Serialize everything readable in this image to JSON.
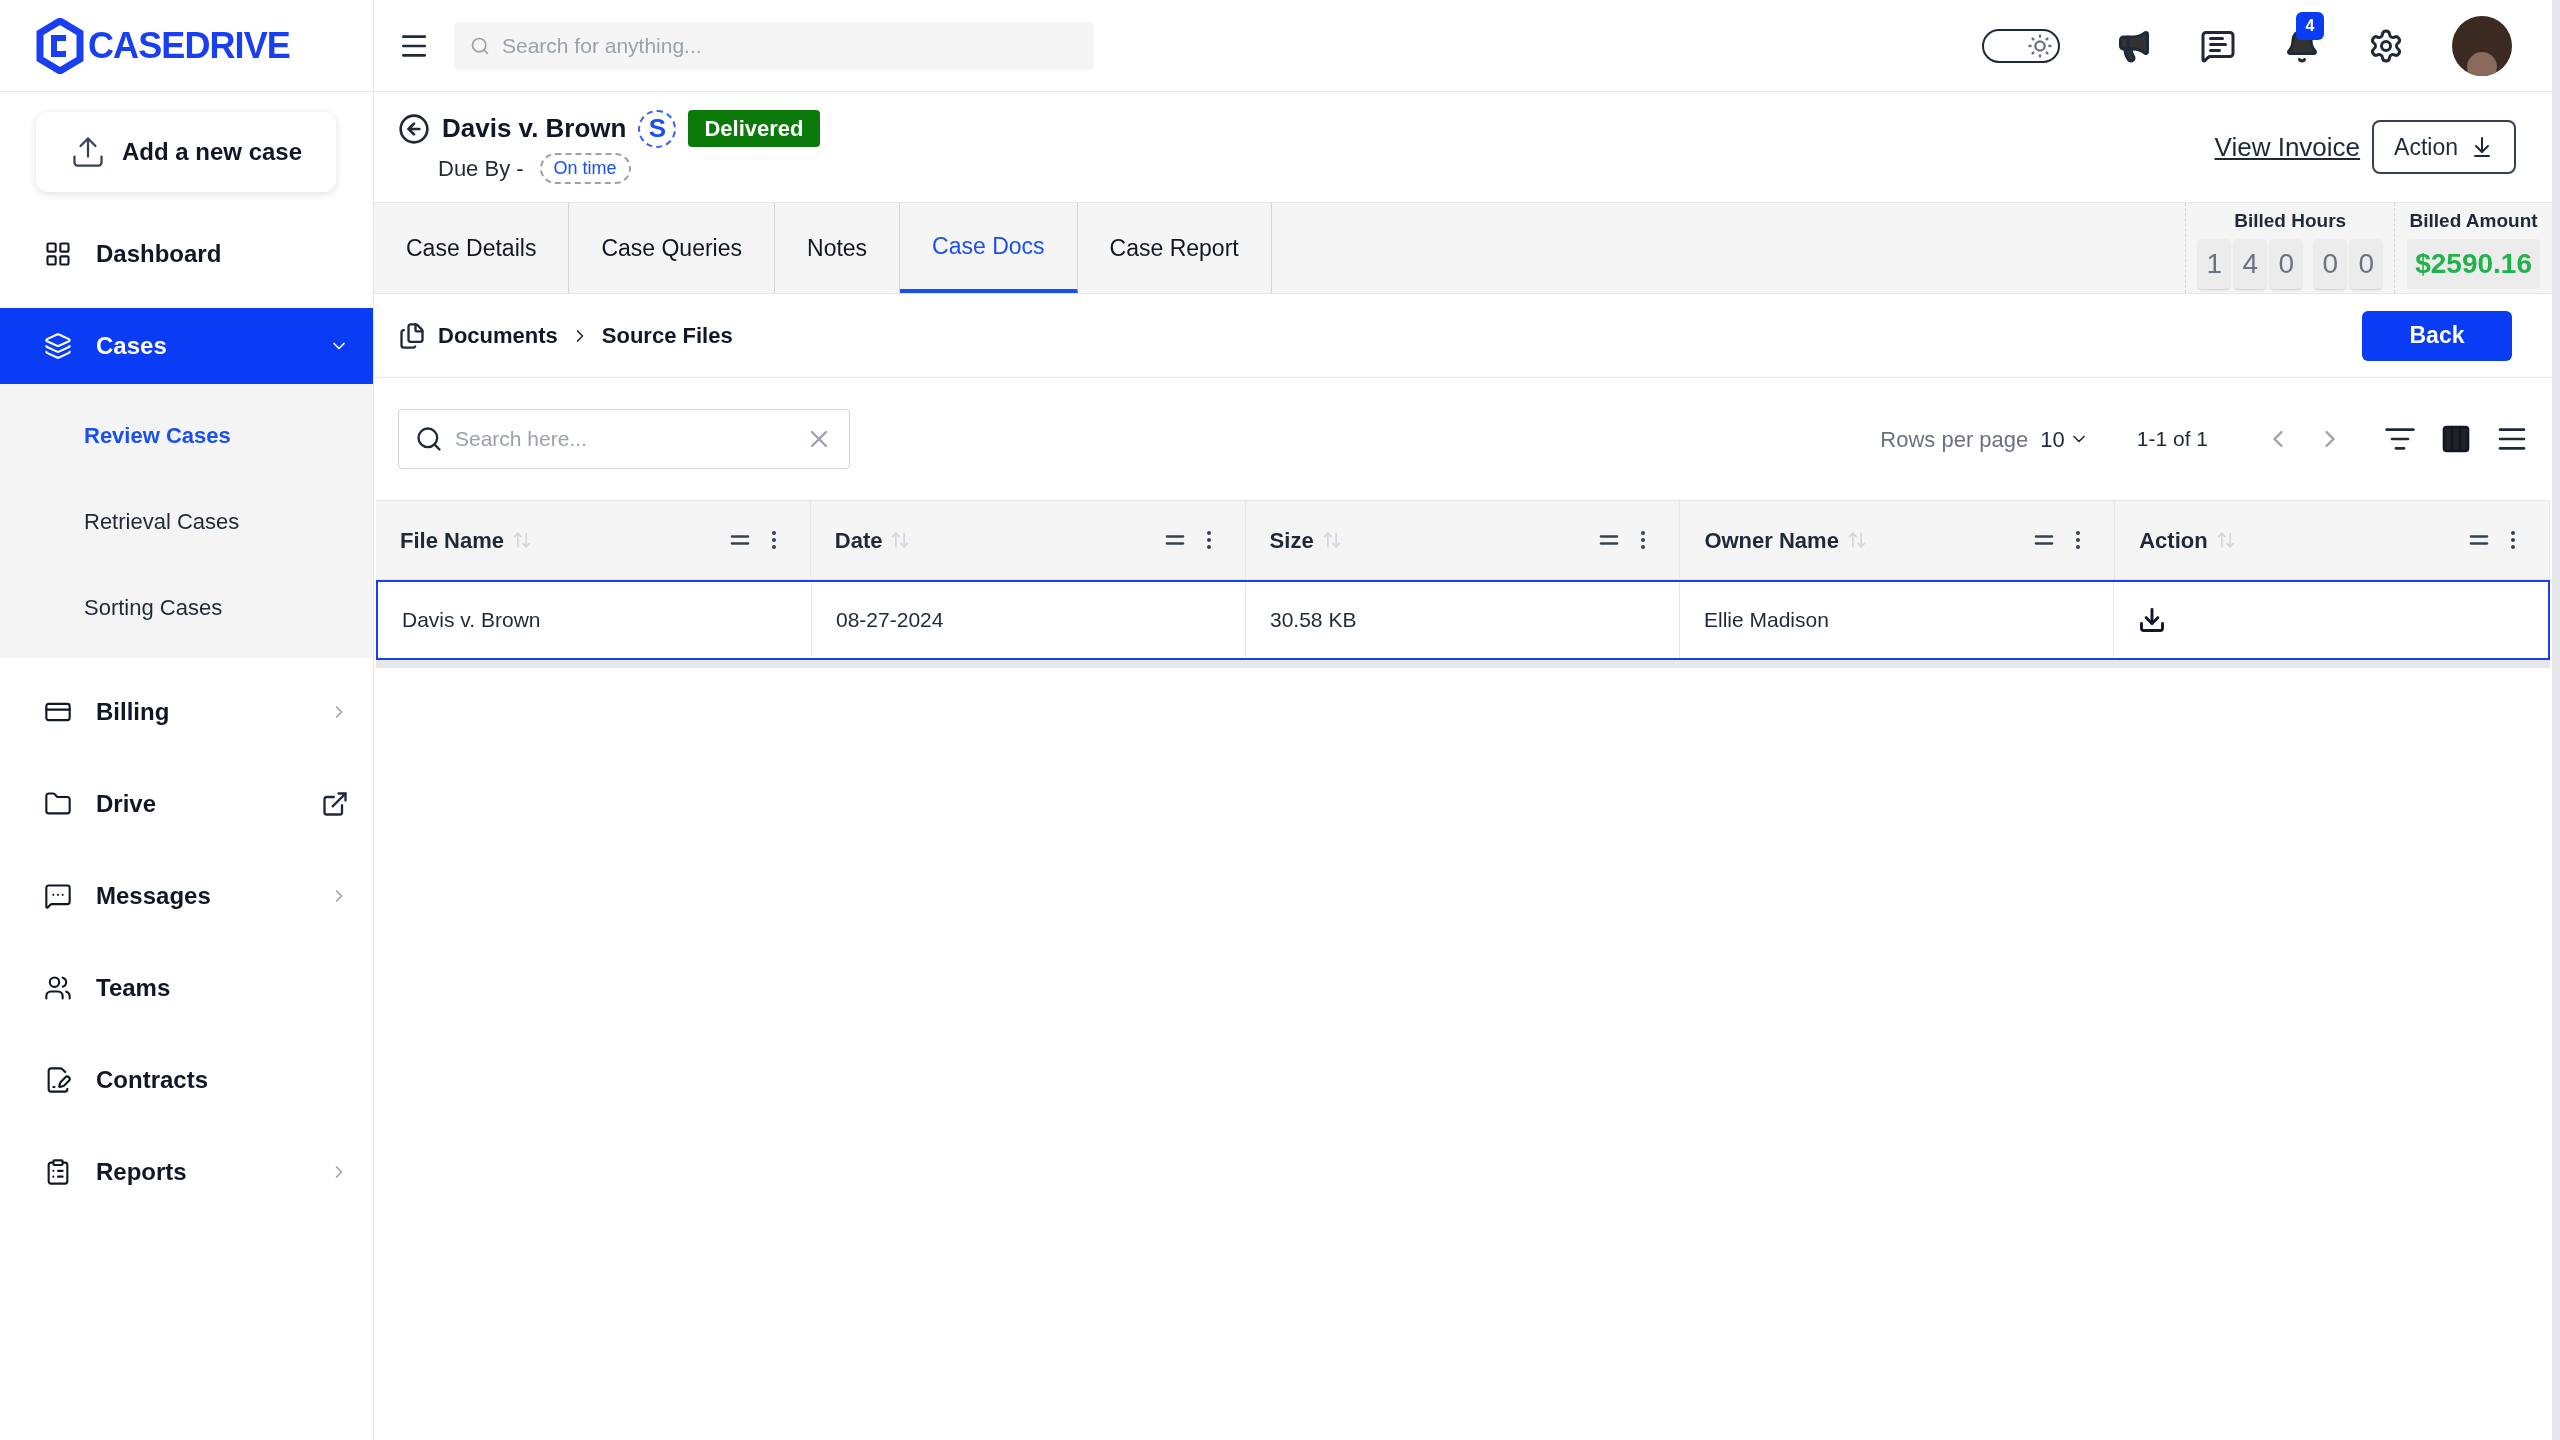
{
  "brand": {
    "name": "CASEDRIVE"
  },
  "sidebar": {
    "add_button": "Add a new case",
    "items": [
      {
        "label": "Dashboard",
        "selected": false
      },
      {
        "label": "Cases",
        "selected": true,
        "expanded": true,
        "children": [
          {
            "label": "Review Cases",
            "selected": true
          },
          {
            "label": "Retrieval Cases",
            "selected": false
          },
          {
            "label": "Sorting Cases",
            "selected": false
          }
        ]
      },
      {
        "label": "Billing",
        "selected": false
      },
      {
        "label": "Drive",
        "selected": false
      },
      {
        "label": "Messages",
        "selected": false
      },
      {
        "label": "Teams",
        "selected": false
      },
      {
        "label": "Contracts",
        "selected": false
      },
      {
        "label": "Reports",
        "selected": false
      }
    ]
  },
  "topbar": {
    "theme_toggle": {
      "on": false
    },
    "search": {
      "placeholder": "Search for anything..."
    },
    "notifications_count": "4"
  },
  "case": {
    "title": "Davis v. Brown",
    "initial": "S",
    "status": "Delivered",
    "due_label": "Due By -",
    "due_status": "On time",
    "view_invoice": "View Invoice",
    "action_button": "Action"
  },
  "tabs": [
    {
      "label": "Case Details",
      "selected": false
    },
    {
      "label": "Case Queries",
      "selected": false
    },
    {
      "label": "Notes",
      "selected": false
    },
    {
      "label": "Case Docs",
      "selected": true
    },
    {
      "label": "Case Report",
      "selected": false
    }
  ],
  "billed_hours": {
    "label": "Billed Hours",
    "groups": [
      [
        "1",
        "4",
        "0"
      ],
      [
        "0",
        "0"
      ]
    ]
  },
  "billed_amount": {
    "label": "Billed Amount",
    "value": "$2590.16"
  },
  "breadcrumb": [
    "Documents",
    "Source Files"
  ],
  "back_button": "Back",
  "table_toolbar": {
    "search": {
      "placeholder": "Search here..."
    },
    "rows_per_page_label": "Rows per page",
    "rows_per_page": "10",
    "range": "1-1 of 1"
  },
  "table": {
    "columns": [
      "File Name",
      "Date",
      "Size",
      "Owner Name",
      "Action"
    ],
    "rows": [
      {
        "cells": [
          "Davis v. Brown",
          "08-27-2024",
          "30.58 KB",
          "Ellie Madison"
        ],
        "selected": true
      }
    ]
  }
}
